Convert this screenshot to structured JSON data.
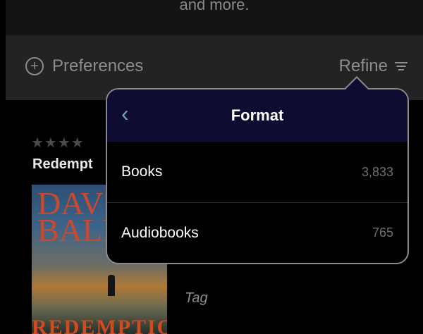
{
  "top_strip": {
    "text": "and more."
  },
  "preferences_bar": {
    "preferences_label": "Preferences",
    "refine_label": "Refine"
  },
  "book": {
    "rating_stars": "★★★★",
    "title": "Redempt",
    "cover_author": "DAV BALD",
    "cover_title": "REDEMPTION",
    "tag": "Tag"
  },
  "format_popover": {
    "title": "Format",
    "back_icon": "chevron-left-icon",
    "options": [
      {
        "label": "Books",
        "count": "3,833"
      },
      {
        "label": "Audiobooks",
        "count": "765"
      }
    ]
  },
  "colors": {
    "popover_header": "#0e0c30",
    "back_chevron": "#6aa8b3",
    "muted_text": "#8c8c8c"
  }
}
